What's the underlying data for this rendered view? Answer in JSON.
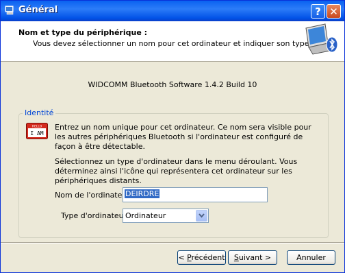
{
  "window": {
    "title": "Général"
  },
  "header": {
    "title": "Nom et type du périphérique :",
    "subtitle": "Vous devez sélectionner un nom pour cet ordinateur et indiquer son type."
  },
  "software_version": "WIDCOMM Bluetooth Software 1.4.2 Build 10",
  "group": {
    "label": "Identité",
    "icon_text_top": "HELLO",
    "icon_text": "I AM",
    "description1": "Entrez un nom unique pour cet ordinateur. Ce nom sera visible pour les autres périphériques Bluetooth si l'ordinateur est configuré de façon à être détectable.",
    "description2": "Sélectionnez un type d'ordinateur dans le menu déroulant. Vous déterminez ainsi l'icône qui représentera cet ordinateur sur les périphériques distants."
  },
  "fields": {
    "name_label": "Nom de l'ordinateur :",
    "name_value": "DEIRDRE",
    "type_label": "Type d'ordinateur :",
    "type_value": "Ordinateur"
  },
  "buttons": {
    "prev_pre": "< ",
    "prev_key": "P",
    "prev_rest": "récédent",
    "next_key": "S",
    "next_rest": "uivant >",
    "cancel": "Annuler"
  }
}
